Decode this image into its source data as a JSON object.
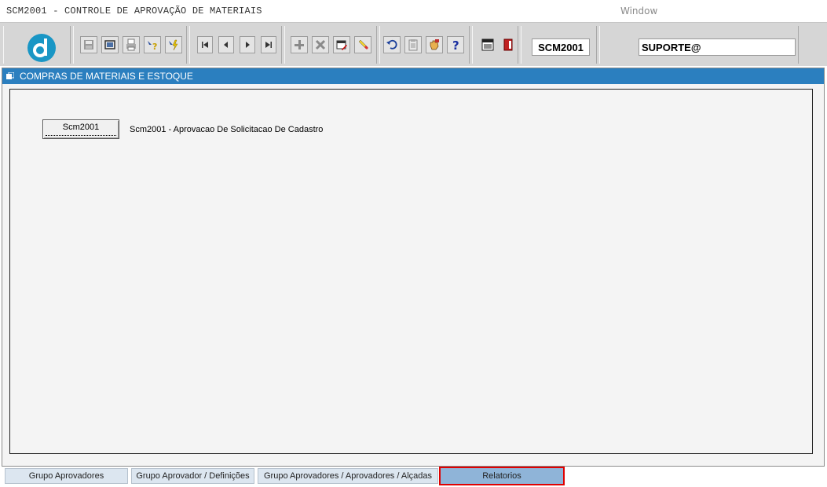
{
  "window": {
    "title": "SCM2001 - CONTROLE DE APROVAÇÃO DE MATERIAIS",
    "menu_window": "Window"
  },
  "toolbar": {
    "module_code": "SCM2001",
    "user": "SUPORTE@",
    "icons": [
      "save-icon",
      "print-preview-icon",
      "print-icon",
      "query-help-icon",
      "execute-query-icon",
      "first-record-icon",
      "previous-record-icon",
      "next-record-icon",
      "last-record-icon",
      "insert-record-icon",
      "delete-record-icon",
      "edit-icon",
      "clear-icon",
      "undo-icon",
      "clipboard-icon",
      "hand-icon",
      "help-icon",
      "menu-icon",
      "exit-icon"
    ]
  },
  "frame": {
    "title": "COMPRAS DE MATERIAIS E ESTOQUE"
  },
  "main": {
    "button_label": "Scm2001",
    "description": "Scm2001 - Aprovacao De Solicitacao De Cadastro"
  },
  "tabs": [
    {
      "label": "Grupo Aprovadores"
    },
    {
      "label": "Grupo Aprovador / Definições"
    },
    {
      "label": "Grupo Aprovadores / Aprovadores / Alçadas"
    },
    {
      "label": "Relatorios",
      "active": true
    }
  ],
  "colors": {
    "header_blue": "#2b7fbf",
    "logo_blue": "#1996c5",
    "active_tab": "#8fb4d8",
    "highlight": "#e00000"
  }
}
